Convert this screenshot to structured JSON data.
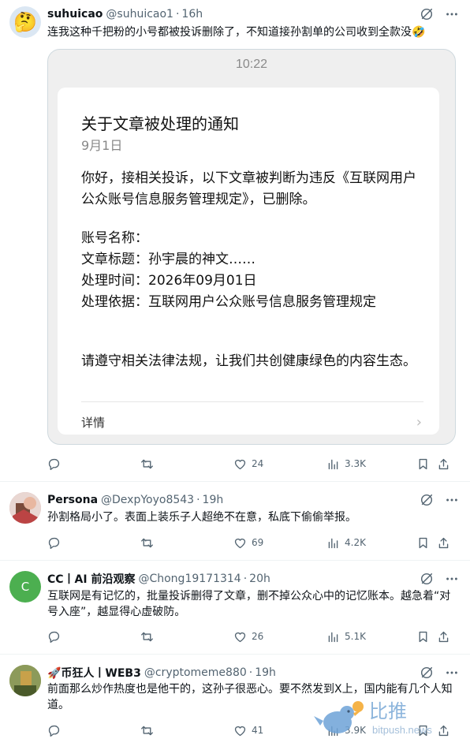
{
  "tweets": [
    {
      "name": "suhuicao",
      "handle": "@suhuicao1",
      "time": "16h",
      "text": "连我这种千把粉的小号都被投诉删除了，不知道接孙割单的公司收到全款没🤣",
      "replies": "",
      "retweets": "",
      "likes": "24",
      "views": "3.3K",
      "avatar_color": "#f6d35c"
    },
    {
      "name": "Persona",
      "handle": "@DexpYoyo8543",
      "time": "19h",
      "text": "孙割格局小了。表面上装乐子人超绝不在意，私底下偷偷举报。",
      "replies": "",
      "retweets": "",
      "likes": "69",
      "views": "4.2K",
      "avatar_color": "#c9a0a0"
    },
    {
      "name": "CC丨AI 前沿观察",
      "handle": "@Chong19171314",
      "time": "20h",
      "text": "互联网是有记忆的，批量投诉删得了文章，删不掉公众心中的记忆账本。越急着“对号入座”，越显得心虚破防。",
      "replies": "",
      "retweets": "",
      "likes": "26",
      "views": "5.1K",
      "avatar_letter": "C",
      "avatar_color": "#4caf50"
    },
    {
      "name": "🚀币狂人丨WEB3",
      "handle": "@cryptomeme880",
      "time": "19h",
      "text": "前面那么炒作热度也是他干的，这孙子很恶心。要不然发到X上，国内能有几个人知道。",
      "replies": "",
      "retweets": "",
      "likes": "41",
      "views": "3.9K",
      "avatar_color": "#7a8a4a"
    }
  ],
  "screenshot": {
    "status_time": "10:22",
    "title": "关于文章被处理的通知",
    "date": "9月1日",
    "intro": "你好，接相关投诉，以下文章被判断为违反《互联网用户公众账号信息服务管理规定》，已删除。",
    "account_label": "账号名称：",
    "article_label": "文章标题：孙宇晨的神文……",
    "time_label": "处理时间：2026年09月01日",
    "basis_label": "处理依据：互联网用户公众账号信息服务管理规定",
    "closing": "请遵守相关法律法规，让我们共创健康绿色的内容生态。",
    "detail_link": "详情",
    "chevron": "›"
  },
  "watermark": {
    "text": "比推",
    "sub": "bitpush.news"
  },
  "colors": {
    "text_primary": "#0f1419",
    "text_secondary": "#536471",
    "divider": "#eff3f4"
  }
}
